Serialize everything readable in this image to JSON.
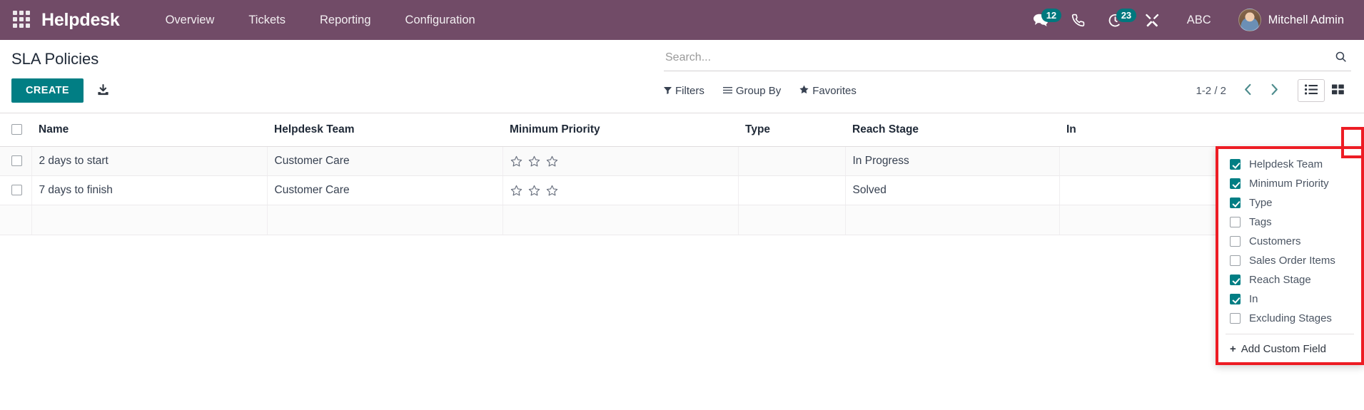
{
  "navbar": {
    "apps_icon": "apps-grid-icon",
    "brand": "Helpdesk",
    "menu": [
      {
        "label": "Overview"
      },
      {
        "label": "Tickets"
      },
      {
        "label": "Reporting"
      },
      {
        "label": "Configuration"
      }
    ],
    "right": {
      "messages_icon": "chat-bubbles-icon",
      "messages_count": "12",
      "phone_icon": "phone-icon",
      "activity_icon": "clock-activity-icon",
      "activity_count": "23",
      "tools_icon": "wrench-screwdriver-icon",
      "abc_label": "ABC",
      "avatar_icon": "user-avatar",
      "user_name": "Mitchell Admin"
    }
  },
  "control_panel": {
    "page_title": "SLA Policies",
    "create_label": "CREATE",
    "import_icon": "import-download-icon",
    "search": {
      "placeholder": "Search...",
      "value": "",
      "search_icon": "search-icon"
    },
    "filters": [
      {
        "label": "Filters",
        "icon": "funnel-icon"
      },
      {
        "label": "Group By",
        "icon": "list-lines-icon"
      },
      {
        "label": "Favorites",
        "icon": "star-icon"
      }
    ],
    "pager": {
      "range": "1-2 / 2",
      "prev_icon": "chevron-left-icon",
      "next_icon": "chevron-right-icon"
    },
    "views": [
      {
        "name": "list-view",
        "icon": "list-view-icon",
        "active": true
      },
      {
        "name": "kanban-view",
        "icon": "kanban-view-icon",
        "active": false
      }
    ]
  },
  "table": {
    "columns": [
      {
        "key": "name",
        "label": "Name"
      },
      {
        "key": "team",
        "label": "Helpdesk Team"
      },
      {
        "key": "priority",
        "label": "Minimum Priority"
      },
      {
        "key": "type",
        "label": "Type"
      },
      {
        "key": "stage",
        "label": "Reach Stage"
      },
      {
        "key": "in",
        "label": "In"
      }
    ],
    "rows": [
      {
        "name": "2 days to start",
        "team": "Customer Care",
        "priority_stars": 3,
        "priority_filled": 0,
        "type": "",
        "stage": "In Progress",
        "in": ""
      },
      {
        "name": "7 days to finish",
        "team": "Customer Care",
        "priority_stars": 3,
        "priority_filled": 0,
        "type": "",
        "stage": "Solved",
        "in": ""
      }
    ],
    "options_button_icon": "vertical-dots-icon"
  },
  "optional_columns_dropdown": {
    "items": [
      {
        "label": "Helpdesk Team",
        "checked": true
      },
      {
        "label": "Minimum Priority",
        "checked": true
      },
      {
        "label": "Type",
        "checked": true
      },
      {
        "label": "Tags",
        "checked": false
      },
      {
        "label": "Customers",
        "checked": false
      },
      {
        "label": "Sales Order Items",
        "checked": false
      },
      {
        "label": "Reach Stage",
        "checked": true
      },
      {
        "label": "In",
        "checked": true
      },
      {
        "label": "Excluding Stages",
        "checked": false
      }
    ],
    "add_custom_field": "Add Custom Field",
    "plus_icon": "plus-icon"
  },
  "colors": {
    "navbar": "#714B67",
    "accent_teal": "#017E84",
    "highlight_red": "#ED1C24",
    "text_dark": "#1F2937"
  }
}
